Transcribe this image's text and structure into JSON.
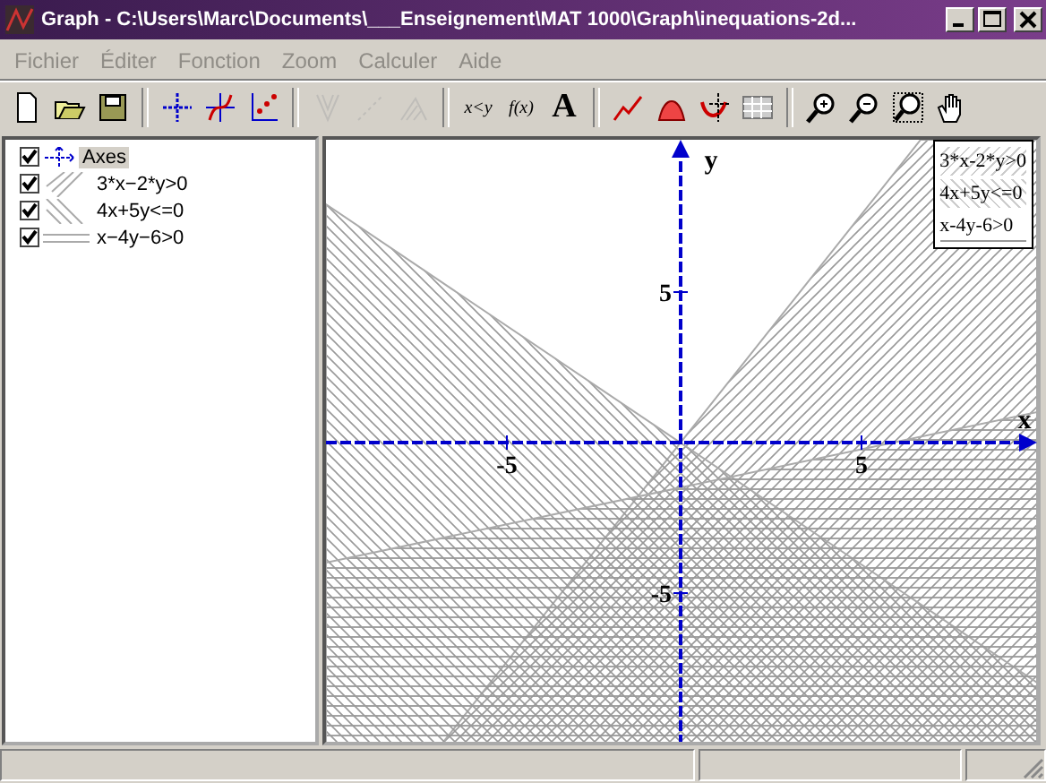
{
  "window": {
    "title": "Graph - C:\\Users\\Marc\\Documents\\___Enseignement\\MAT 1000\\Graph\\inequations-2d..."
  },
  "menu": [
    {
      "label": "Fichier",
      "disabled": true
    },
    {
      "label": "Éditer",
      "disabled": true
    },
    {
      "label": "Fonction",
      "disabled": true
    },
    {
      "label": "Zoom",
      "disabled": true
    },
    {
      "label": "Calculer",
      "disabled": true
    },
    {
      "label": "Aide",
      "disabled": true
    }
  ],
  "toolbar": [
    [
      {
        "kind": "new",
        "disabled": false
      },
      {
        "kind": "open",
        "disabled": false
      },
      {
        "kind": "save",
        "disabled": false
      }
    ],
    [
      {
        "kind": "axes",
        "disabled": false
      },
      {
        "kind": "function",
        "disabled": false
      },
      {
        "kind": "points",
        "disabled": false
      }
    ],
    [
      {
        "kind": "tangent",
        "disabled": true
      },
      {
        "kind": "relation",
        "disabled": true
      },
      {
        "kind": "shading",
        "disabled": true
      }
    ],
    [
      {
        "kind": "label",
        "label": "x<y",
        "disabled": false
      },
      {
        "kind": "label",
        "label": "f(x)",
        "disabled": false
      },
      {
        "kind": "label",
        "label": "A",
        "disabled": false
      }
    ],
    [
      {
        "kind": "curve",
        "disabled": false
      },
      {
        "kind": "area",
        "disabled": false
      },
      {
        "kind": "evaluate",
        "disabled": false
      },
      {
        "kind": "table",
        "disabled": false
      }
    ],
    [
      {
        "kind": "zoom-in",
        "disabled": false
      },
      {
        "kind": "zoom-out",
        "disabled": false
      },
      {
        "kind": "zoom-square",
        "disabled": false
      },
      {
        "kind": "hand",
        "disabled": false
      }
    ]
  ],
  "tree": [
    {
      "label": "Axes",
      "kind": "axes",
      "checked": true,
      "selected": true
    },
    {
      "label": "3*x−2*y>0",
      "kind": "slash",
      "checked": true,
      "selected": false
    },
    {
      "label": "4x+5y<=0",
      "kind": "backslash",
      "checked": true,
      "selected": false
    },
    {
      "label": "x−4y−6>0",
      "kind": "horizontal",
      "checked": true,
      "selected": false
    }
  ],
  "graph": {
    "x_axis_label": "x",
    "y_axis_label": "y",
    "x_tick_labels": [
      "-5",
      "5"
    ],
    "y_tick_labels": [
      "5",
      "-5"
    ],
    "legend": [
      {
        "label": "3*x-2*y>0",
        "kind": "slash"
      },
      {
        "label": "4x+5y<=0",
        "kind": "backslash"
      },
      {
        "label": "x-4y-6>0",
        "kind": "horizontal"
      }
    ]
  }
}
